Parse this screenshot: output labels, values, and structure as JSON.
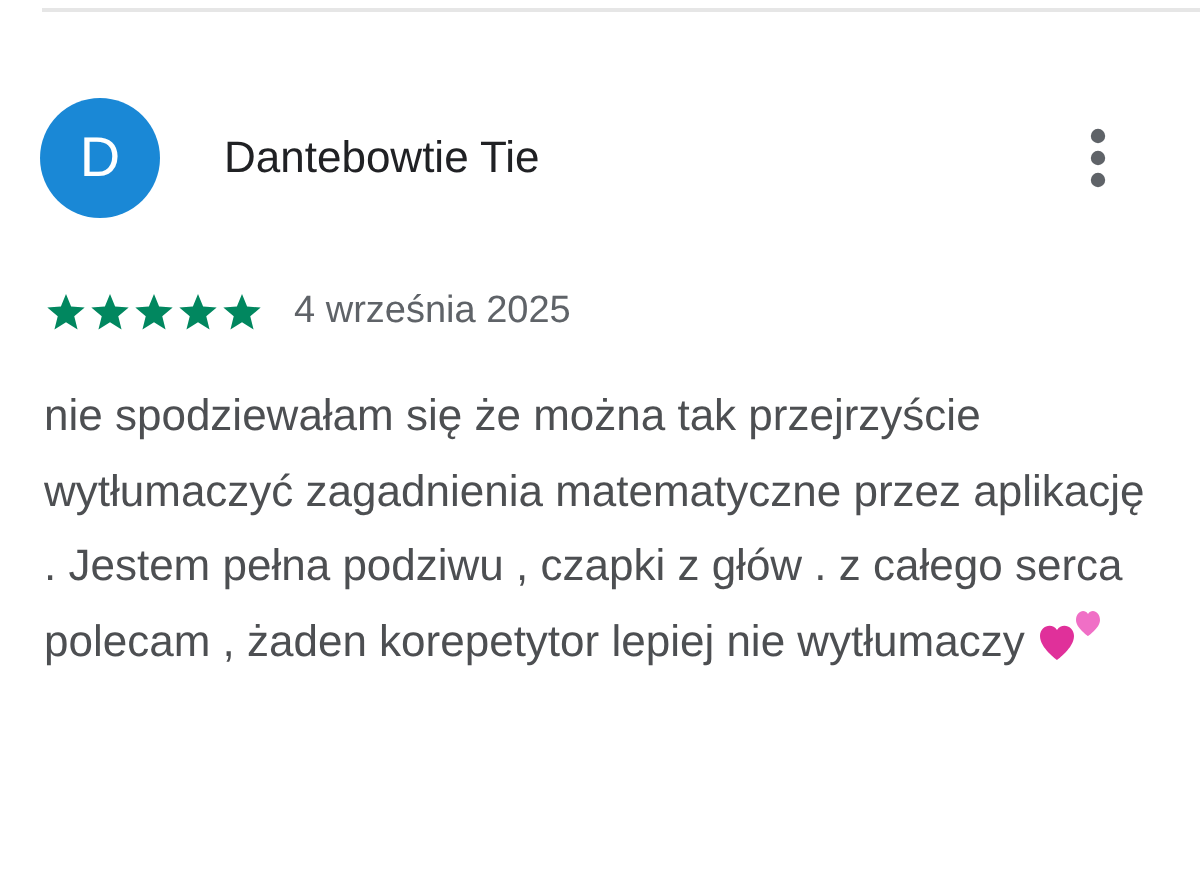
{
  "review": {
    "avatar_letter": "D",
    "author": "Dantebowtie Tie",
    "stars": 5,
    "date": "4 września 2025",
    "text": "nie spodziewałam się że można tak przejrzyście wytłumaczyć zagadnienia matematyczne przez aplikację . Jestem pełna podziwu , czapki z głów . z całego serca polecam , żaden korepetytor lepiej nie wytłumaczy"
  }
}
